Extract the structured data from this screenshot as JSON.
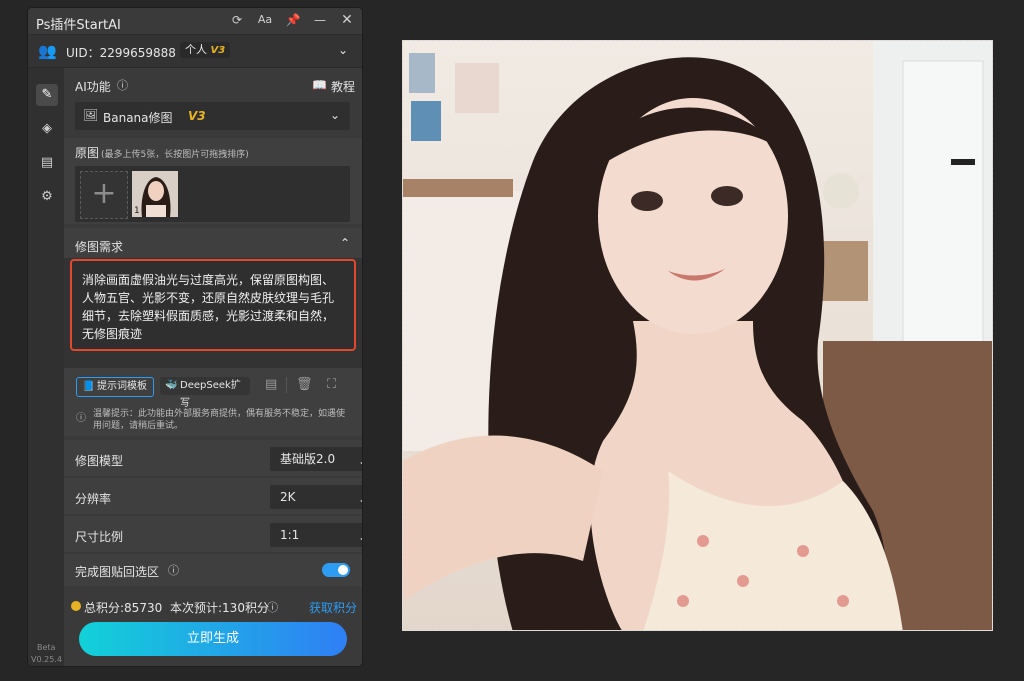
{
  "window": {
    "title": "Ps插件StartAI"
  },
  "uid_bar": {
    "uid": "UID：2299659888",
    "plan": "个人",
    "plan_version": "V3"
  },
  "ai_function": {
    "label": "AI功能",
    "tutorial": "教程",
    "selected_model": "Banana修图",
    "selected_version": "V3"
  },
  "original_image": {
    "label": "原图",
    "hint": "(最多上传5张，长按图片可拖拽排序)",
    "thumbnail_index": "1"
  },
  "edit_request": {
    "label": "修图需求",
    "text": "消除画面虚假油光与过度高光，保留原图构图、人物五官、光影不变，还原自然皮肤纹理与毛孔细节，去除塑料假面质感，光影过渡柔和自然，无修图痕迹"
  },
  "prompt_tools": {
    "template_button": "提示词模板",
    "deepseek_button": "DeepSeek扩写"
  },
  "notice": {
    "text": "温馨提示：此功能由外部服务商提供，偶有服务不稳定，如遇使用问题，请稍后重试。"
  },
  "settings": {
    "model_label": "修图模型",
    "model_value": "基础版2.0",
    "resolution_label": "分辨率",
    "resolution_value": "2K",
    "ratio_label": "尺寸比例",
    "ratio_value": "1:1",
    "paste_label": "完成图贴回选区",
    "paste_enabled": true
  },
  "footer": {
    "points": "总积分:85730",
    "estimate": "本次预计:130积分",
    "get_points": "获取积分",
    "generate": "立即生成",
    "beta": "Beta",
    "version": "V0.25.4"
  },
  "colors": {
    "accent": "#2d9cf2",
    "highlight_border": "#e2482d",
    "gold": "#e7b325"
  }
}
